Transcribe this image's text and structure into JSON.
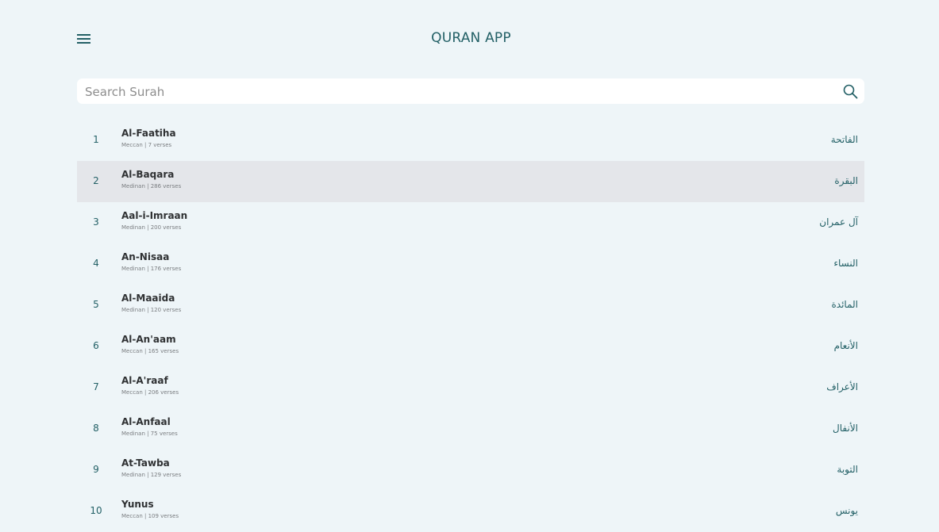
{
  "app": {
    "title": "QURAN APP"
  },
  "search": {
    "placeholder": "Search Surah",
    "value": ""
  },
  "icons": {
    "menu": "hamburger-menu-icon",
    "search": "search-icon"
  },
  "colors": {
    "accent": "#236066",
    "background": "#eef5f8",
    "highlight_row": "#e4e6ea"
  },
  "surahs": [
    {
      "number": "1",
      "name": "Al-Faatiha",
      "meta": "Meccan | 7 verses",
      "arabic": "الفاتحة",
      "active": false
    },
    {
      "number": "2",
      "name": "Al-Baqara",
      "meta": "Medinan | 286 verses",
      "arabic": "البقرة",
      "active": true
    },
    {
      "number": "3",
      "name": "Aal-i-Imraan",
      "meta": "Medinan | 200 verses",
      "arabic": "آل عمران",
      "active": false
    },
    {
      "number": "4",
      "name": "An-Nisaa",
      "meta": "Medinan | 176 verses",
      "arabic": "النساء",
      "active": false
    },
    {
      "number": "5",
      "name": "Al-Maaida",
      "meta": "Medinan | 120 verses",
      "arabic": "المائدة",
      "active": false
    },
    {
      "number": "6",
      "name": "Al-An'aam",
      "meta": "Meccan | 165 verses",
      "arabic": "الأنعام",
      "active": false
    },
    {
      "number": "7",
      "name": "Al-A'raaf",
      "meta": "Meccan | 206 verses",
      "arabic": "الأعراف",
      "active": false
    },
    {
      "number": "8",
      "name": "Al-Anfaal",
      "meta": "Medinan | 75 verses",
      "arabic": "الأنفال",
      "active": false
    },
    {
      "number": "9",
      "name": "At-Tawba",
      "meta": "Medinan | 129 verses",
      "arabic": "التوبة",
      "active": false
    },
    {
      "number": "10",
      "name": "Yunus",
      "meta": "Meccan | 109 verses",
      "arabic": "يونس",
      "active": false
    }
  ]
}
